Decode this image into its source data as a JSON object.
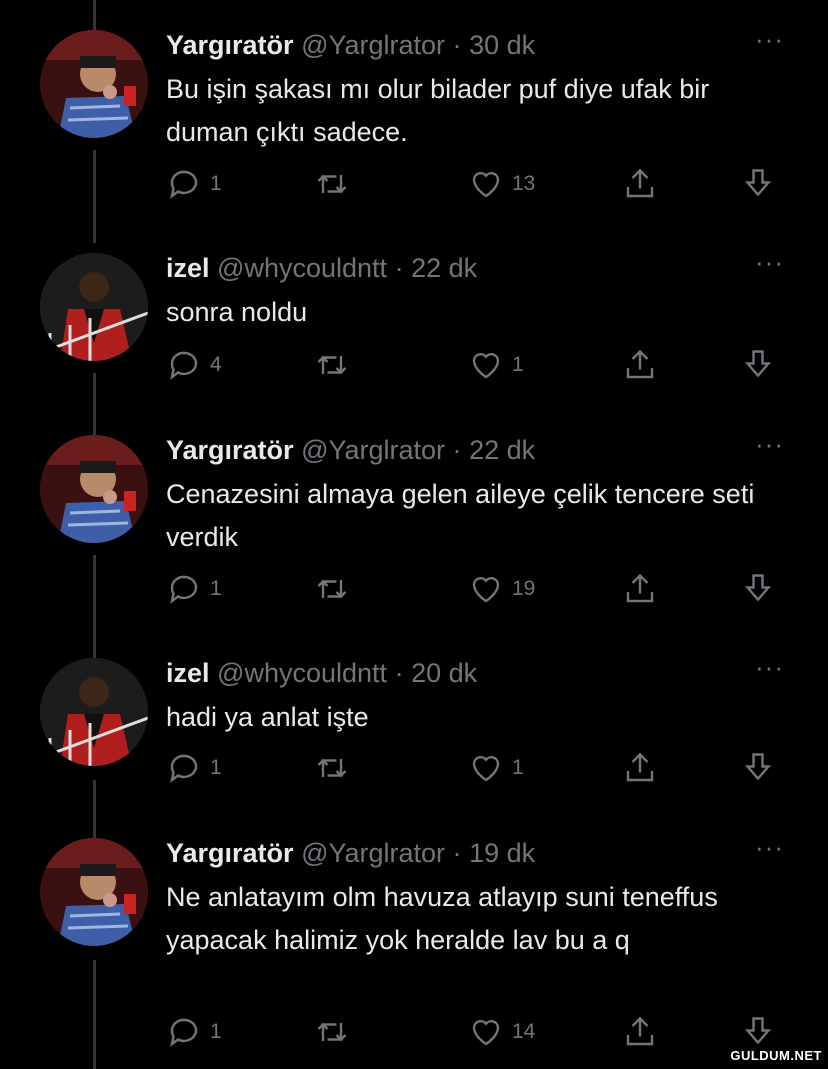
{
  "tweets": [
    {
      "name": "Yargıratör",
      "handle": "@Yarglrator",
      "time": "30 dk",
      "text": "Bu işin şakası mı olur bilader puf diye ufak bir duman çıktı sadece.",
      "replies": "1",
      "retweets": "",
      "likes": "13",
      "avatar": "man-smoking-avatar"
    },
    {
      "name": "izel",
      "handle": "@whycouldntt",
      "time": "22 dk",
      "text": "sonra noldu",
      "replies": "4",
      "retweets": "",
      "likes": "1",
      "avatar": "red-jacket-avatar"
    },
    {
      "name": "Yargıratör",
      "handle": "@Yarglrator",
      "time": "22 dk",
      "text": "Cenazesini almaya gelen aileye çelik tencere seti verdik",
      "replies": "1",
      "retweets": "",
      "likes": "19",
      "avatar": "man-smoking-avatar"
    },
    {
      "name": "izel",
      "handle": "@whycouldntt",
      "time": "20 dk",
      "text": "hadi ya anlat işte",
      "replies": "1",
      "retweets": "",
      "likes": "1",
      "avatar": "red-jacket-avatar"
    },
    {
      "name": "Yargıratör",
      "handle": "@Yarglrator",
      "time": "19 dk",
      "text": "Ne anlatayım olm havuza atlayıp suni teneffus yapacak halimiz yok heralde lav bu a q",
      "replies": "1",
      "retweets": "",
      "likes": "14",
      "avatar": "man-smoking-avatar"
    }
  ],
  "separator": "·",
  "more_label": "···",
  "watermark": "GULDUM.NET",
  "colors": {
    "background": "#000000",
    "text": "#e7e9ea",
    "muted": "#71767b",
    "line": "#333639"
  }
}
